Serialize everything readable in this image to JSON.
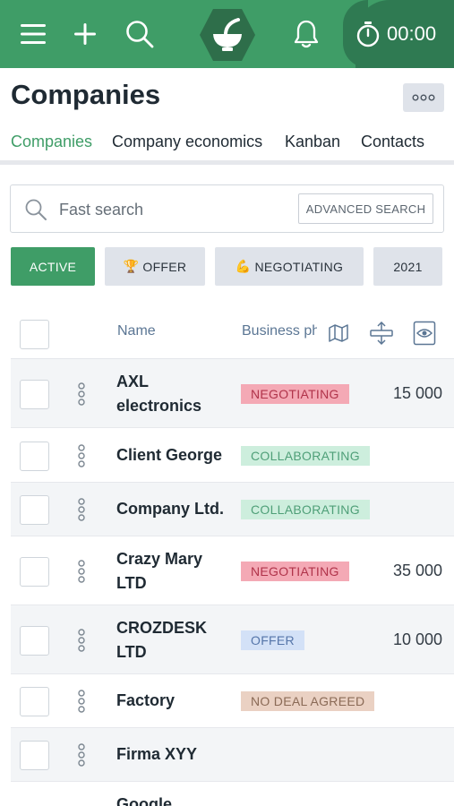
{
  "topbar": {
    "timer_text": "00:00",
    "bg_color": "#3f9d67",
    "timer_bg_color": "#2f7a52",
    "icons": [
      "menu-icon",
      "plus-icon",
      "search-icon",
      "bowl-logo-icon",
      "bell-icon",
      "stopwatch-icon"
    ]
  },
  "header": {
    "title": "Companies",
    "more_label": "◦◦◦"
  },
  "tabs": [
    {
      "label": "Companies",
      "active": true
    },
    {
      "label": "Company economics",
      "active": false
    },
    {
      "label": "Kanban",
      "active": false
    },
    {
      "label": "Contacts",
      "active": false
    }
  ],
  "search": {
    "placeholder": "Fast search",
    "value": "",
    "advanced_label": "ADVANCED SEARCH"
  },
  "filters": [
    {
      "label": "ACTIVE",
      "emoji": "",
      "active": true
    },
    {
      "label": "OFFER",
      "emoji": "🏆",
      "active": false
    },
    {
      "label": "NEGOTIATING",
      "emoji": "💪",
      "active": false
    },
    {
      "label": "2021",
      "emoji": "",
      "active": false
    }
  ],
  "table": {
    "columns": {
      "name": "Name",
      "business_phase": "Business ph"
    },
    "rows": [
      {
        "name": "AXL electronics",
        "status": "NEGOTIATING",
        "status_type": "negotiating",
        "amount": "15 000"
      },
      {
        "name": "Client George",
        "status": "COLLABORATING",
        "status_type": "collaborating",
        "amount": ""
      },
      {
        "name": "Company Ltd.",
        "status": "COLLABORATING",
        "status_type": "collaborating",
        "amount": ""
      },
      {
        "name": "Crazy Mary LTD",
        "status": "NEGOTIATING",
        "status_type": "negotiating",
        "amount": "35 000"
      },
      {
        "name": "CROZDESK LTD",
        "status": "OFFER",
        "status_type": "offer",
        "amount": "10 000"
      },
      {
        "name": "Factory",
        "status": "NO DEAL AGREED",
        "status_type": "nodeal",
        "amount": ""
      },
      {
        "name": "Firma XYY",
        "status": "",
        "status_type": "",
        "amount": ""
      },
      {
        "name": "Google",
        "status": "",
        "status_type": "",
        "amount": ""
      }
    ]
  },
  "status_colors": {
    "negotiating": {
      "bg": "#f4a9b5",
      "fg": "#b0334a"
    },
    "collaborating": {
      "bg": "#cdeedd",
      "fg": "#4f9f78"
    },
    "offer": {
      "bg": "#d3e1f7",
      "fg": "#5575a9"
    },
    "nodeal": {
      "bg": "#ead1c3",
      "fg": "#8a6a56"
    }
  }
}
